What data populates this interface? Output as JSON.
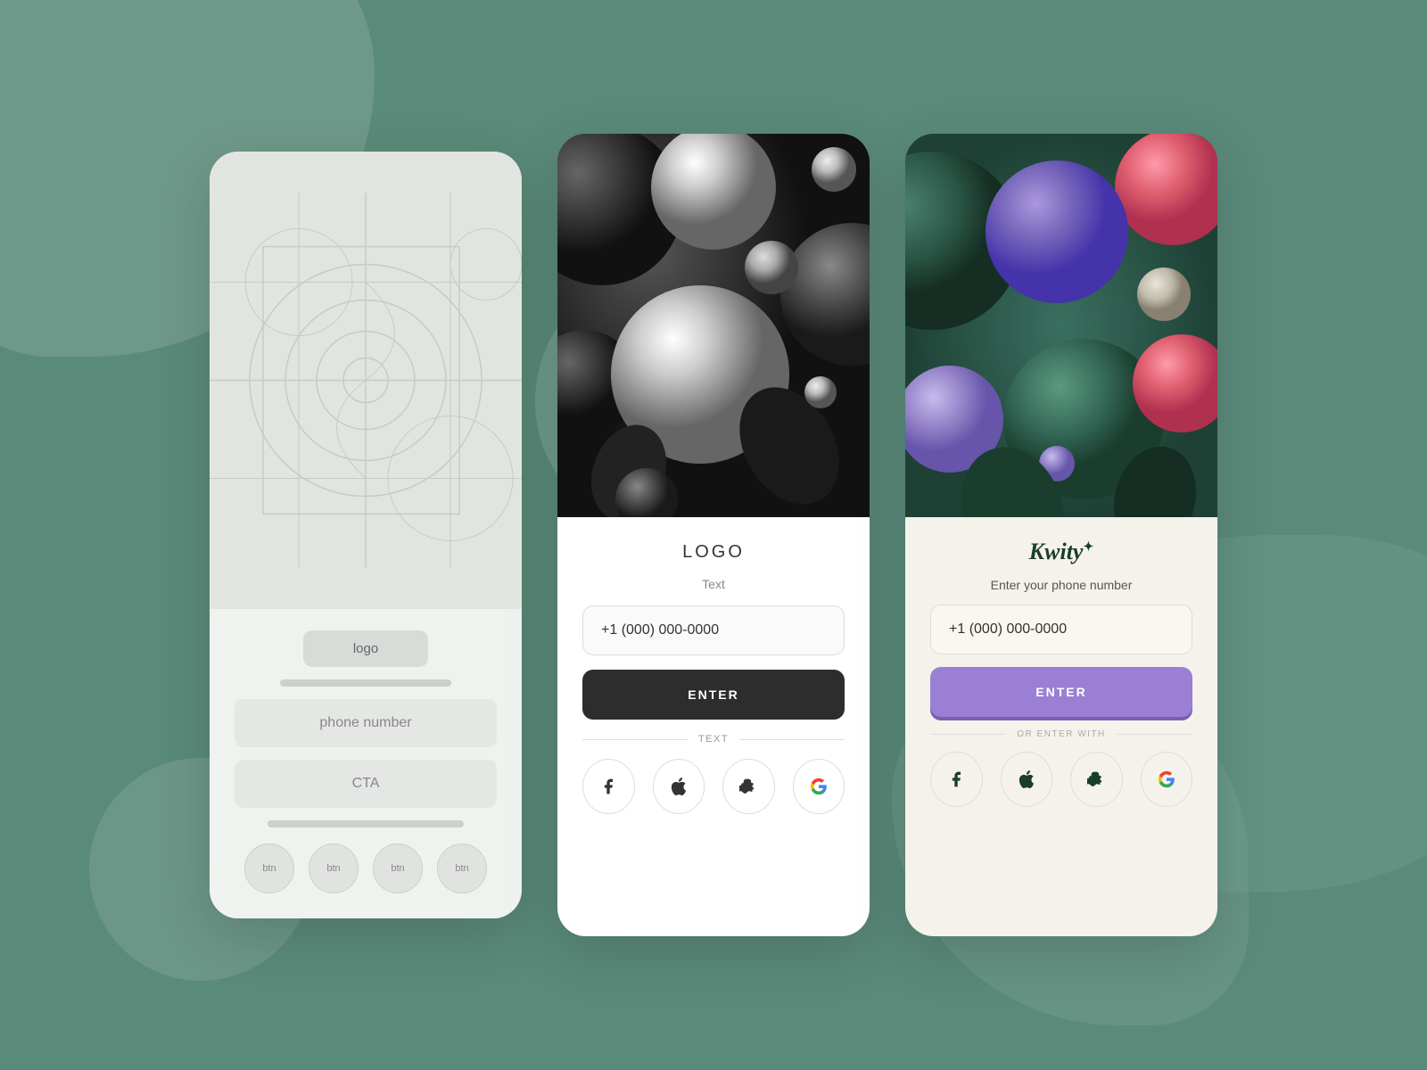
{
  "background": {
    "color": "#5a8a7a"
  },
  "card1": {
    "type": "wireframe",
    "logo_label": "logo",
    "phone_placeholder": "phone number",
    "cta_label": "CTA",
    "social_btns": [
      "btn",
      "btn",
      "btn",
      "btn"
    ]
  },
  "card2": {
    "type": "dark",
    "logo_label": "LOGO",
    "subtitle": "Text",
    "phone_placeholder": "+1 (000) 000-0000",
    "enter_label": "ENTER",
    "divider_text": "TEXT",
    "social_icons": [
      "facebook",
      "apple",
      "snapchat",
      "google"
    ]
  },
  "card3": {
    "type": "kwity",
    "logo_label": "Kwity",
    "logo_suffix": "✦",
    "subtitle": "Enter your phone number",
    "phone_placeholder": "+1 (000) 000-0000",
    "enter_label": "ENTER",
    "divider_text": "OR ENTER WITH",
    "social_icons": [
      "facebook",
      "apple",
      "snapchat",
      "google"
    ]
  }
}
